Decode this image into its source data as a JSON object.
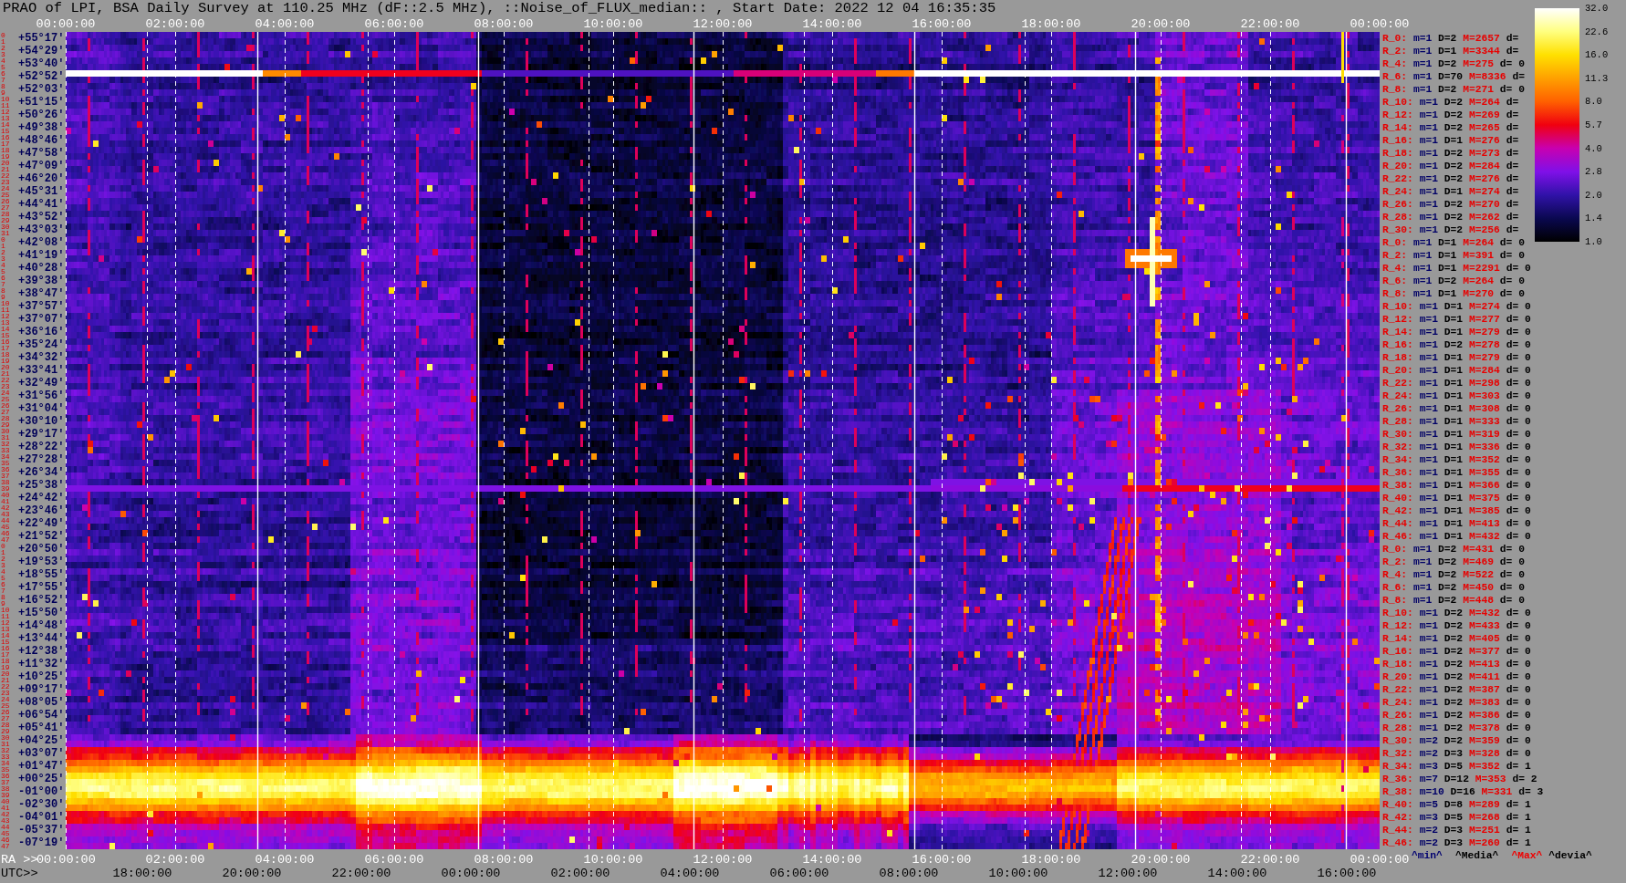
{
  "title": "PRAO of LPI, BSA Daily Survey at 110.25 MHz (dF::2.5 MHz), ::Noise_of_FLUX_median:: , Start Date: 2022 12 04 16:35:35",
  "top_axis": {
    "labels": [
      "00:00:00",
      "02:00:00",
      "04:00:00",
      "06:00:00",
      "08:00:00",
      "10:00:00",
      "12:00:00",
      "14:00:00",
      "16:00:00",
      "18:00:00",
      "20:00:00",
      "22:00:00",
      "00:00:00"
    ]
  },
  "strip_groups": [
    {
      "row_numbers": [
        "0",
        "1",
        "2",
        "3",
        "4",
        "5",
        "6",
        "7",
        "8",
        "9",
        "10",
        "11",
        "12",
        "13",
        "14",
        "15",
        "16",
        "17",
        "18",
        "19",
        "20",
        "21",
        "22",
        "23",
        "24",
        "25",
        "26",
        "27",
        "28",
        "29",
        "30",
        "31"
      ],
      "rows": [
        {
          "declination": "+55°17'",
          "beam": "R_0:",
          "min": "m=1",
          "median": "D=2",
          "max": "M=2657",
          "deviation": "d="
        },
        {
          "declination": "+54°29'",
          "beam": "R_2:",
          "min": "m=1",
          "median": "D=1",
          "max": "M=3344",
          "deviation": "d="
        },
        {
          "declination": "+53°40'",
          "beam": "R_4:",
          "min": "m=1",
          "median": "D=2",
          "max": "M=275",
          "deviation": "d= 0"
        },
        {
          "declination": "+52°52'",
          "beam": "R_6:",
          "min": "m=1",
          "median": "D=70",
          "max": "M=8336",
          "deviation": "d="
        },
        {
          "declination": "+52°03'",
          "beam": "R_8:",
          "min": "m=1",
          "median": "D=2",
          "max": "M=271",
          "deviation": "d= 0"
        },
        {
          "declination": "+51°15'",
          "beam": "R_10:",
          "min": "m=1",
          "median": "D=2",
          "max": "M=264",
          "deviation": "d="
        },
        {
          "declination": "+50°26'",
          "beam": "R_12:",
          "min": "m=1",
          "median": "D=2",
          "max": "M=269",
          "deviation": "d="
        },
        {
          "declination": "+49°38'",
          "beam": "R_14:",
          "min": "m=1",
          "median": "D=2",
          "max": "M=265",
          "deviation": "d="
        },
        {
          "declination": "+48°46'",
          "beam": "R_16:",
          "min": "m=1",
          "median": "D=1",
          "max": "M=276",
          "deviation": "d="
        },
        {
          "declination": "+47°58'",
          "beam": "R_18:",
          "min": "m=1",
          "median": "D=2",
          "max": "M=273",
          "deviation": "d="
        },
        {
          "declination": "+47°09'",
          "beam": "R_20:",
          "min": "m=1",
          "median": "D=2",
          "max": "M=284",
          "deviation": "d="
        },
        {
          "declination": "+46°20'",
          "beam": "R_22:",
          "min": "m=1",
          "median": "D=2",
          "max": "M=276",
          "deviation": "d="
        },
        {
          "declination": "+45°31'",
          "beam": "R_24:",
          "min": "m=1",
          "median": "D=1",
          "max": "M=274",
          "deviation": "d="
        },
        {
          "declination": "+44°41'",
          "beam": "R_26:",
          "min": "m=1",
          "median": "D=2",
          "max": "M=270",
          "deviation": "d="
        },
        {
          "declination": "+43°52'",
          "beam": "R_28:",
          "min": "m=1",
          "median": "D=2",
          "max": "M=262",
          "deviation": "d="
        },
        {
          "declination": "+43°03'",
          "beam": "R_30:",
          "min": "m=1",
          "median": "D=2",
          "max": "M=256",
          "deviation": "d="
        }
      ]
    },
    {
      "row_numbers": [
        "0",
        "1",
        "2",
        "3",
        "4",
        "5",
        "6",
        "7",
        "8",
        "9",
        "10",
        "11",
        "12",
        "13",
        "14",
        "15",
        "16",
        "17",
        "18",
        "19",
        "20",
        "21",
        "22",
        "23",
        "24",
        "25",
        "26",
        "27",
        "28",
        "29",
        "30",
        "31",
        "32",
        "33",
        "34",
        "35",
        "36",
        "37",
        "38",
        "39",
        "40",
        "41",
        "42",
        "43",
        "44",
        "45",
        "46",
        "47"
      ],
      "rows": [
        {
          "declination": "+42°08'",
          "beam": "R_0:",
          "min": "m=1",
          "median": "D=1",
          "max": "M=264",
          "deviation": "d= 0"
        },
        {
          "declination": "+41°19'",
          "beam": "R_2:",
          "min": "m=1",
          "median": "D=1",
          "max": "M=391",
          "deviation": "d= 0"
        },
        {
          "declination": "+40°28'",
          "beam": "R_4:",
          "min": "m=1",
          "median": "D=1",
          "max": "M=2291",
          "deviation": "d= 0"
        },
        {
          "declination": "+39°38'",
          "beam": "R_6:",
          "min": "m=1",
          "median": "D=2",
          "max": "M=264",
          "deviation": "d= 0"
        },
        {
          "declination": "+38°47'",
          "beam": "R_8:",
          "min": "m=1",
          "median": "D=1",
          "max": "M=270",
          "deviation": "d= 0"
        },
        {
          "declination": "+37°57'",
          "beam": "R_10:",
          "min": "m=1",
          "median": "D=1",
          "max": "M=274",
          "deviation": "d= 0"
        },
        {
          "declination": "+37°07'",
          "beam": "R_12:",
          "min": "m=1",
          "median": "D=1",
          "max": "M=277",
          "deviation": "d= 0"
        },
        {
          "declination": "+36°16'",
          "beam": "R_14:",
          "min": "m=1",
          "median": "D=1",
          "max": "M=279",
          "deviation": "d= 0"
        },
        {
          "declination": "+35°24'",
          "beam": "R_16:",
          "min": "m=1",
          "median": "D=2",
          "max": "M=278",
          "deviation": "d= 0"
        },
        {
          "declination": "+34°32'",
          "beam": "R_18:",
          "min": "m=1",
          "median": "D=1",
          "max": "M=279",
          "deviation": "d= 0"
        },
        {
          "declination": "+33°41'",
          "beam": "R_20:",
          "min": "m=1",
          "median": "D=1",
          "max": "M=284",
          "deviation": "d= 0"
        },
        {
          "declination": "+32°49'",
          "beam": "R_22:",
          "min": "m=1",
          "median": "D=1",
          "max": "M=298",
          "deviation": "d= 0"
        },
        {
          "declination": "+31°56'",
          "beam": "R_24:",
          "min": "m=1",
          "median": "D=1",
          "max": "M=303",
          "deviation": "d= 0"
        },
        {
          "declination": "+31°04'",
          "beam": "R_26:",
          "min": "m=1",
          "median": "D=1",
          "max": "M=308",
          "deviation": "d= 0"
        },
        {
          "declination": "+30°10'",
          "beam": "R_28:",
          "min": "m=1",
          "median": "D=1",
          "max": "M=333",
          "deviation": "d= 0"
        },
        {
          "declination": "+29°17'",
          "beam": "R_30:",
          "min": "m=1",
          "median": "D=1",
          "max": "M=319",
          "deviation": "d= 0"
        },
        {
          "declination": "+28°22'",
          "beam": "R_32:",
          "min": "m=1",
          "median": "D=1",
          "max": "M=336",
          "deviation": "d= 0"
        },
        {
          "declination": "+27°28'",
          "beam": "R_34:",
          "min": "m=1",
          "median": "D=1",
          "max": "M=352",
          "deviation": "d= 0"
        },
        {
          "declination": "+26°34'",
          "beam": "R_36:",
          "min": "m=1",
          "median": "D=1",
          "max": "M=355",
          "deviation": "d= 0"
        },
        {
          "declination": "+25°38'",
          "beam": "R_38:",
          "min": "m=1",
          "median": "D=1",
          "max": "M=366",
          "deviation": "d= 0"
        },
        {
          "declination": "+24°42'",
          "beam": "R_40:",
          "min": "m=1",
          "median": "D=1",
          "max": "M=375",
          "deviation": "d= 0"
        },
        {
          "declination": "+23°46'",
          "beam": "R_42:",
          "min": "m=1",
          "median": "D=1",
          "max": "M=385",
          "deviation": "d= 0"
        },
        {
          "declination": "+22°49'",
          "beam": "R_44:",
          "min": "m=1",
          "median": "D=1",
          "max": "M=413",
          "deviation": "d= 0"
        },
        {
          "declination": "+21°52'",
          "beam": "R_46:",
          "min": "m=1",
          "median": "D=1",
          "max": "M=432",
          "deviation": "d= 0"
        }
      ]
    },
    {
      "row_numbers": [
        "0",
        "1",
        "2",
        "3",
        "4",
        "5",
        "6",
        "7",
        "8",
        "9",
        "10",
        "11",
        "12",
        "13",
        "14",
        "15",
        "16",
        "17",
        "18",
        "19",
        "20",
        "21",
        "22",
        "23",
        "24",
        "25",
        "26",
        "27",
        "28",
        "29",
        "30",
        "31",
        "32",
        "33",
        "34",
        "35",
        "36",
        "37",
        "38",
        "39",
        "40",
        "41",
        "42",
        "43",
        "44",
        "45",
        "46",
        "47"
      ],
      "rows": [
        {
          "declination": "+20°50'",
          "beam": "R_0:",
          "min": "m=1",
          "median": "D=2",
          "max": "M=431",
          "deviation": "d= 0"
        },
        {
          "declination": "+19°53'",
          "beam": "R_2:",
          "min": "m=1",
          "median": "D=2",
          "max": "M=469",
          "deviation": "d= 0"
        },
        {
          "declination": "+18°55'",
          "beam": "R_4:",
          "min": "m=1",
          "median": "D=2",
          "max": "M=522",
          "deviation": "d= 0"
        },
        {
          "declination": "+17°55'",
          "beam": "R_6:",
          "min": "m=1",
          "median": "D=2",
          "max": "M=450",
          "deviation": "d= 0"
        },
        {
          "declination": "+16°52'",
          "beam": "R_8:",
          "min": "m=1",
          "median": "D=2",
          "max": "M=448",
          "deviation": "d= 0"
        },
        {
          "declination": "+15°50'",
          "beam": "R_10:",
          "min": "m=1",
          "median": "D=2",
          "max": "M=432",
          "deviation": "d= 0"
        },
        {
          "declination": "+14°48'",
          "beam": "R_12:",
          "min": "m=1",
          "median": "D=2",
          "max": "M=433",
          "deviation": "d= 0"
        },
        {
          "declination": "+13°44'",
          "beam": "R_14:",
          "min": "m=1",
          "median": "D=2",
          "max": "M=405",
          "deviation": "d= 0"
        },
        {
          "declination": "+12°38'",
          "beam": "R_16:",
          "min": "m=1",
          "median": "D=2",
          "max": "M=377",
          "deviation": "d= 0"
        },
        {
          "declination": "+11°32'",
          "beam": "R_18:",
          "min": "m=1",
          "median": "D=2",
          "max": "M=413",
          "deviation": "d= 0"
        },
        {
          "declination": "+10°25'",
          "beam": "R_20:",
          "min": "m=1",
          "median": "D=2",
          "max": "M=411",
          "deviation": "d= 0"
        },
        {
          "declination": "+09°17'",
          "beam": "R_22:",
          "min": "m=1",
          "median": "D=2",
          "max": "M=387",
          "deviation": "d= 0"
        },
        {
          "declination": "+08°05'",
          "beam": "R_24:",
          "min": "m=1",
          "median": "D=2",
          "max": "M=383",
          "deviation": "d= 0"
        },
        {
          "declination": "+06°54'",
          "beam": "R_26:",
          "min": "m=1",
          "median": "D=2",
          "max": "M=386",
          "deviation": "d= 0"
        },
        {
          "declination": "+05°41'",
          "beam": "R_28:",
          "min": "m=1",
          "median": "D=2",
          "max": "M=378",
          "deviation": "d= 0"
        },
        {
          "declination": "+04°25'",
          "beam": "R_30:",
          "min": "m=2",
          "median": "D=2",
          "max": "M=359",
          "deviation": "d= 0"
        },
        {
          "declination": "+03°07'",
          "beam": "R_32:",
          "min": "m=2",
          "median": "D=3",
          "max": "M=328",
          "deviation": "d= 0"
        },
        {
          "declination": "+01°47'",
          "beam": "R_34:",
          "min": "m=3",
          "median": "D=5",
          "max": "M=352",
          "deviation": "d= 1"
        },
        {
          "declination": "+00°25'",
          "beam": "R_36:",
          "min": "m=7",
          "median": "D=12",
          "max": "M=353",
          "deviation": "d= 2"
        },
        {
          "declination": "-01°00'",
          "beam": "R_38:",
          "min": "m=10",
          "median": "D=16",
          "max": "M=331",
          "deviation": "d= 3"
        },
        {
          "declination": "-02°30'",
          "beam": "R_40:",
          "min": "m=5",
          "median": "D=8",
          "max": "M=289",
          "deviation": "d= 1"
        },
        {
          "declination": "-04°01'",
          "beam": "R_42:",
          "min": "m=3",
          "median": "D=5",
          "max": "M=268",
          "deviation": "d= 1"
        },
        {
          "declination": "-05°37'",
          "beam": "R_44:",
          "min": "m=2",
          "median": "D=3",
          "max": "M=251",
          "deviation": "d= 1"
        },
        {
          "declination": "-07°19'",
          "beam": "R_46:",
          "min": "m=2",
          "median": "D=3",
          "max": "M=260",
          "deviation": "d= 1"
        }
      ]
    }
  ],
  "color_scale": {
    "labels": [
      "32.0",
      "22.6",
      "16.0",
      "11.3",
      "8.0",
      "5.7",
      "4.0",
      "2.8",
      "2.0",
      "1.4",
      "1.0"
    ]
  },
  "stats_legend": [
    {
      "kind": "min",
      "label": "^min^"
    },
    {
      "kind": "median",
      "label": "^Media^"
    },
    {
      "kind": "max",
      "label": "^Max^"
    },
    {
      "kind": "deviation",
      "label": "^devia^"
    }
  ],
  "ra_axis": {
    "title": "RA >>",
    "labels": [
      "00:00:00",
      "02:00:00",
      "04:00:00",
      "06:00:00",
      "08:00:00",
      "10:00:00",
      "12:00:00",
      "14:00:00",
      "16:00:00",
      "18:00:00",
      "20:00:00",
      "22:00:00",
      "00:00:00"
    ]
  },
  "utc_axis": {
    "title": "UTC>>",
    "labels": [
      "18:00:00",
      "20:00:00",
      "22:00:00",
      "00:00:00",
      "02:00:00",
      "04:00:00",
      "06:00:00",
      "08:00:00",
      "10:00:00",
      "12:00:00",
      "14:00:00",
      "16:00:00"
    ]
  }
}
